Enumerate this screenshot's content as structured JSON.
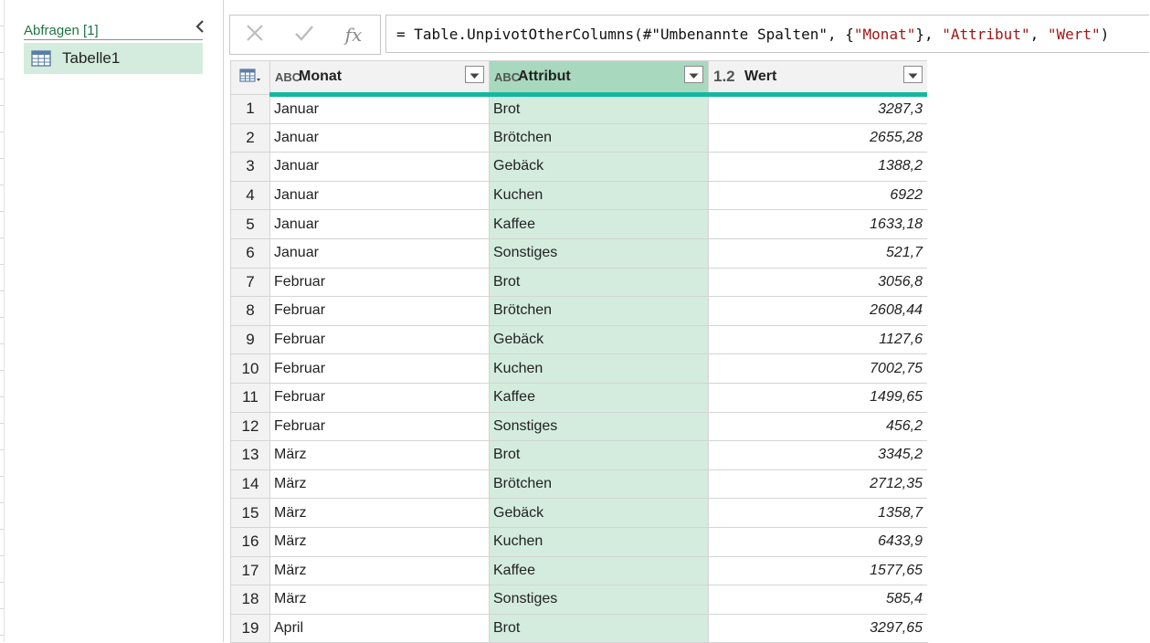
{
  "queries_pane": {
    "title": "Abfragen [1]",
    "items": [
      {
        "label": "Tabelle1",
        "icon": "table-icon"
      }
    ]
  },
  "formula_bar": {
    "cancel_icon": "close-icon",
    "commit_icon": "check-icon",
    "fx_label": "fx",
    "formula_parts": [
      {
        "text": "= Table.UnpivotOtherColumns(#\"Umbenannte Spalten\", {",
        "kind": "code"
      },
      {
        "text": "\"Monat\"",
        "kind": "str"
      },
      {
        "text": "}, ",
        "kind": "code"
      },
      {
        "text": "\"Attribut\"",
        "kind": "str"
      },
      {
        "text": ", ",
        "kind": "code"
      },
      {
        "text": "\"Wert\"",
        "kind": "str"
      },
      {
        "text": ")",
        "kind": "code"
      }
    ]
  },
  "table": {
    "columns": [
      {
        "name": "Monat",
        "type_label": "ABC",
        "type": "text"
      },
      {
        "name": "Attribut",
        "type_label": "ABC",
        "type": "text",
        "selected": true
      },
      {
        "name": "Wert",
        "type_label": "1.2",
        "type": "number"
      }
    ],
    "rows": [
      [
        "1",
        "Januar",
        "Brot",
        "3287,3"
      ],
      [
        "2",
        "Januar",
        "Brötchen",
        "2655,28"
      ],
      [
        "3",
        "Januar",
        "Gebäck",
        "1388,2"
      ],
      [
        "4",
        "Januar",
        "Kuchen",
        "6922"
      ],
      [
        "5",
        "Januar",
        "Kaffee",
        "1633,18"
      ],
      [
        "6",
        "Januar",
        "Sonstiges",
        "521,7"
      ],
      [
        "7",
        "Februar",
        "Brot",
        "3056,8"
      ],
      [
        "8",
        "Februar",
        "Brötchen",
        "2608,44"
      ],
      [
        "9",
        "Februar",
        "Gebäck",
        "1127,6"
      ],
      [
        "10",
        "Februar",
        "Kuchen",
        "7002,75"
      ],
      [
        "11",
        "Februar",
        "Kaffee",
        "1499,65"
      ],
      [
        "12",
        "Februar",
        "Sonstiges",
        "456,2"
      ],
      [
        "13",
        "März",
        "Brot",
        "3345,2"
      ],
      [
        "14",
        "März",
        "Brötchen",
        "2712,35"
      ],
      [
        "15",
        "März",
        "Gebäck",
        "1358,7"
      ],
      [
        "16",
        "März",
        "Kuchen",
        "6433,9"
      ],
      [
        "17",
        "März",
        "Kaffee",
        "1577,65"
      ],
      [
        "18",
        "März",
        "Sonstiges",
        "585,4"
      ],
      [
        "19",
        "April",
        "Brot",
        "3297,65"
      ]
    ]
  },
  "colors": {
    "accent_green": "#217346",
    "selected_column": "#d4ecdd",
    "quality_bar": "#14b8a0",
    "string_literal": "#a31515"
  }
}
